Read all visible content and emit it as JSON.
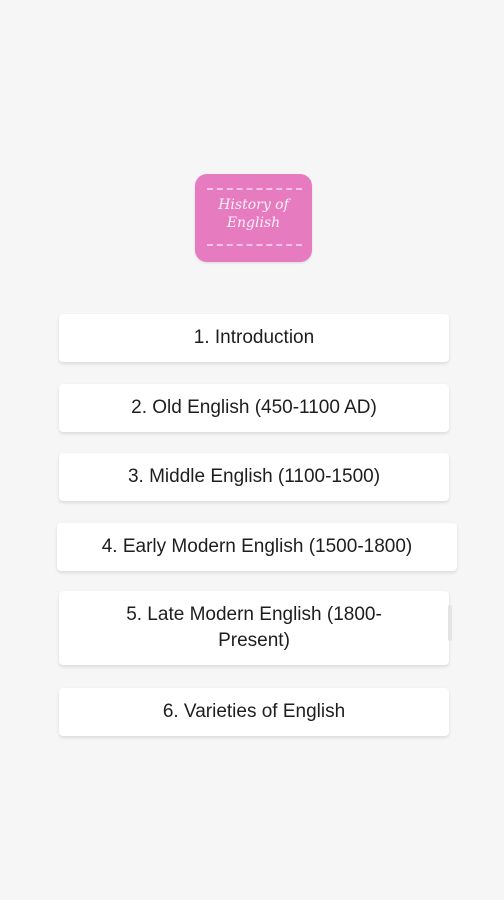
{
  "logo": {
    "text": "History of\nEnglish",
    "colors": {
      "background": "#e77bc0",
      "accent": "#ffffff"
    }
  },
  "menu": {
    "items": [
      {
        "label": "1. Introduction"
      },
      {
        "label": "2. Old English (450-1100 AD)"
      },
      {
        "label": "3. Middle English (1100-1500)"
      },
      {
        "label": "4. Early Modern English (1500-1800)"
      },
      {
        "label": "5. Late Modern English (1800-Present)"
      },
      {
        "label": "6. Varieties of English"
      }
    ]
  },
  "colors": {
    "screen_background": "#f6f6f6",
    "card_background": "#ffffff",
    "text": "#1e1e1e"
  }
}
